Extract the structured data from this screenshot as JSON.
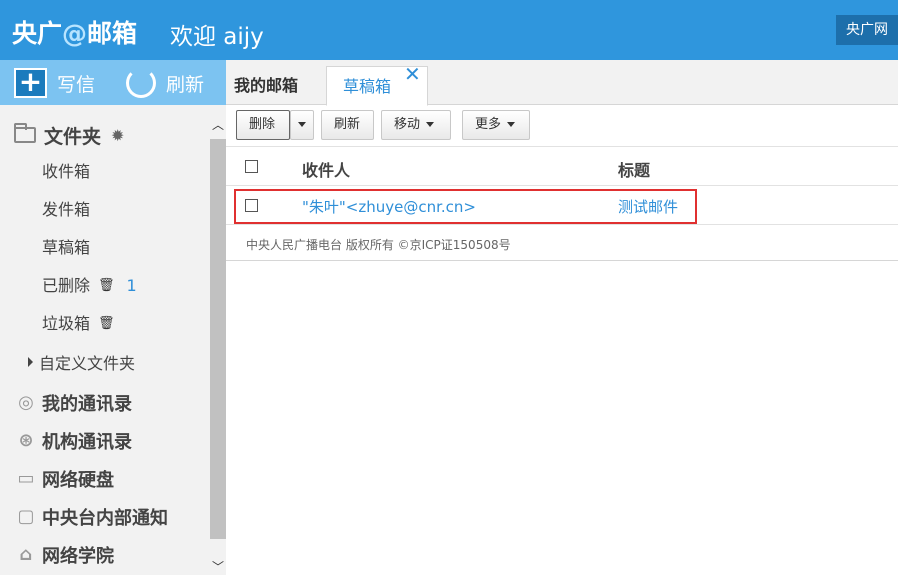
{
  "header": {
    "logo_prefix": "央广",
    "logo_at": "@",
    "logo_suffix": "邮箱",
    "welcome": "欢迎 aijy",
    "site_link": "央广网"
  },
  "sidebar": {
    "compose_label": "写信",
    "refresh_label": "刷新",
    "folders_title": "文件夹",
    "folders": [
      {
        "label": "收件箱"
      },
      {
        "label": "发件箱"
      },
      {
        "label": "草稿箱"
      },
      {
        "label": "已删除",
        "count": "1"
      },
      {
        "label": "垃圾箱"
      }
    ],
    "custom_folders": "自定义文件夹",
    "sections": [
      {
        "label": "我的通讯录",
        "icon": "contact-icon"
      },
      {
        "label": "机构通讯录",
        "icon": "org-icon"
      },
      {
        "label": "网络硬盘",
        "icon": "disk-icon"
      },
      {
        "label": "中央台内部通知",
        "icon": "chat-icon"
      },
      {
        "label": "网络学院",
        "icon": "home-icon"
      }
    ]
  },
  "tabs": [
    {
      "label": "我的邮箱"
    },
    {
      "label": "草稿箱"
    }
  ],
  "toolbar": {
    "delete": "删除",
    "refresh": "刷新",
    "move": "移动",
    "more": "更多"
  },
  "table": {
    "headers": [
      "收件人",
      "标题"
    ],
    "rows": [
      {
        "recipient": "\"朱叶\"<zhuye@cnr.cn>",
        "subject": "测试邮件"
      }
    ]
  },
  "footer": "中央人民广播电台 版权所有 ©京ICP证150508号",
  "colors": {
    "header_blue": "#2f96dd",
    "actions_blue": "#7cc3f1",
    "link_blue": "#2f8fd8",
    "highlight_red": "#e03030"
  }
}
